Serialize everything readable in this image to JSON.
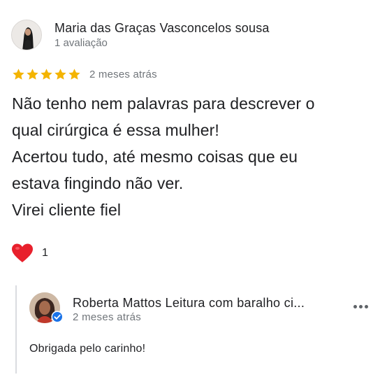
{
  "review": {
    "reviewer_name": "Maria das Graças Vasconcelos sousa",
    "reviewer_review_count": "1 avaliação",
    "rating": 5,
    "rating_max": 5,
    "star_color": "#f4b400",
    "date": "2 meses atrás",
    "text_lines": [
      "Não tenho nem palavras para descrever o",
      "qual cirúrgica é essa mulher!",
      "Acertou tudo, até mesmo coisas que eu",
      "estava fingindo não ver.",
      "Virei cliente fiel"
    ],
    "reaction": {
      "icon": "heart-icon",
      "count": "1",
      "color": "#e8202c"
    }
  },
  "reply": {
    "author_name": "Roberta Mattos Leitura com baralho ci...",
    "date": "2 meses atrás",
    "verified_icon": "verified-badge-icon",
    "verified_color": "#1a73e8",
    "more_icon": "more-options-icon",
    "text": "Obrigada pelo carinho!"
  }
}
